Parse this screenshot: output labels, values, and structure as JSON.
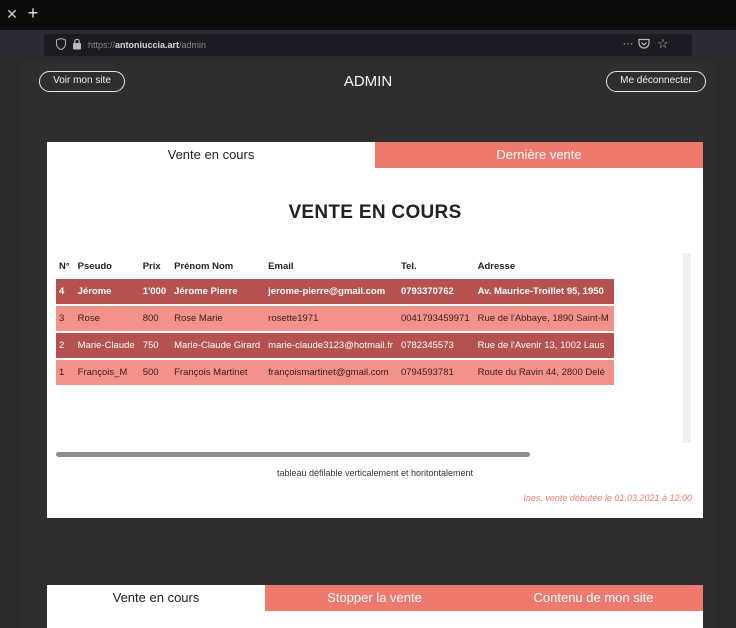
{
  "browser": {
    "url_prefix": "https://",
    "url_domain": "antoniuccia.art",
    "url_path": "/admin",
    "more_glyph": "···",
    "icons": [
      "close-icon",
      "plus-icon",
      "shield-icon",
      "lock-icon",
      "more-icon",
      "pocket-icon",
      "star-icon"
    ]
  },
  "header": {
    "site_button": "Voir mon site",
    "title": "ADMIN",
    "logout_button": "Me déconnecter"
  },
  "tabs": {
    "current": "Vente en cours",
    "last": "Dernière vente"
  },
  "section_title": "VENTE EN COURS",
  "table": {
    "columns": [
      "N°",
      "Pseudo",
      "Prix",
      "Prénom Nom",
      "Email",
      "Tel.",
      "Adresse"
    ],
    "rows": [
      [
        "4",
        "Jérome",
        "1'000",
        "Jérome Pierre",
        "jerome-pierre@gmail.com",
        "0793370762",
        "Av. Maurice-Troillet 95, 1950"
      ],
      [
        "3",
        "Rose",
        "800",
        "Rose Marie",
        "rosette1971",
        "0041793459971",
        "Rue de l'Abbaye, 1890 Saint-M"
      ],
      [
        "2",
        "Marie-Claude",
        "750",
        "Marie-Claude Girard",
        "marie-claude3123@hotmail.fr",
        "0782345573",
        "Rue de l'Avenir 13, 1002 Laus"
      ],
      [
        "1",
        "François_M",
        "500",
        "François Martinet",
        "françoismartinet@gmail.com",
        "0794593781",
        "Route du Ravin 44, 2800 Delé"
      ]
    ]
  },
  "hint": "tableau défilable verticalement et horitontalement",
  "status": "Ines, vente débutée le 01.03.2021 à 12:00",
  "bottom_tabs": [
    "Vente en cours",
    "Stopper la vente",
    "Contenu de mon site"
  ],
  "colors": {
    "accent": "#ee7a6f",
    "row_dark": "#b5514e",
    "row_light": "#f2928a",
    "background": "#2e2e2e"
  }
}
